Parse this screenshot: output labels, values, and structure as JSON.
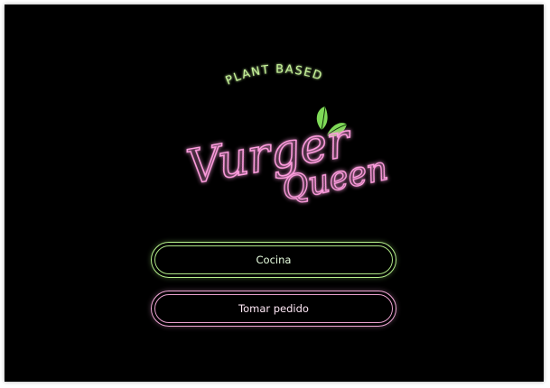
{
  "brand": {
    "tagline": "PLANT BASED",
    "name_line1": "Vurger",
    "name_line2": "Queen",
    "accent_green": "#b6f08c",
    "accent_pink": "#f4a9d9",
    "leaf_icon": "leaves-icon"
  },
  "menu": {
    "kitchen_label": "Cocina",
    "order_label": "Tomar pedido"
  }
}
